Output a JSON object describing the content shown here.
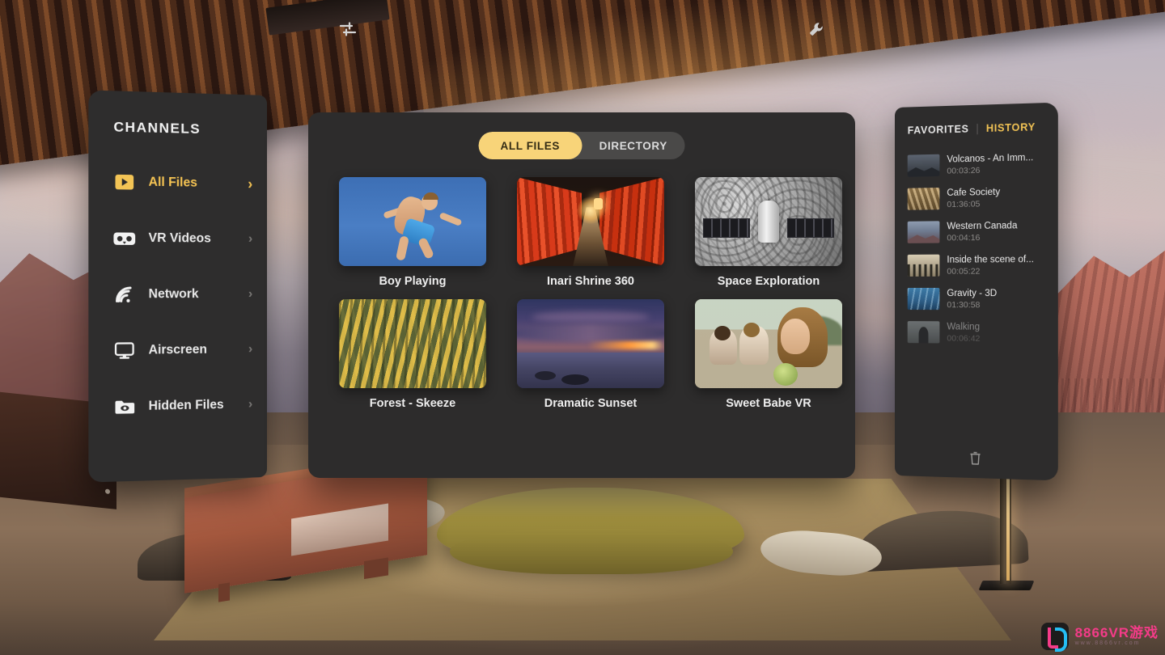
{
  "sidebar": {
    "title": "CHANNELS",
    "items": [
      {
        "label": "All Files",
        "icon": "play-box-icon",
        "chevron": "›",
        "active": true
      },
      {
        "label": "VR Videos",
        "icon": "vr-goggles-icon",
        "chevron": "›",
        "active": false
      },
      {
        "label": "Network",
        "icon": "wifi-icon",
        "chevron": "›",
        "active": false
      },
      {
        "label": "Airscreen",
        "icon": "monitor-icon",
        "chevron": "›",
        "active": false
      },
      {
        "label": "Hidden Files",
        "icon": "folder-eye-icon",
        "chevron": "›",
        "active": false
      }
    ]
  },
  "main": {
    "filter_icon": "sliders-icon",
    "settings_icon": "wrench-icon",
    "tabs": [
      {
        "label": "ALL FILES",
        "active": true
      },
      {
        "label": "DIRECTORY",
        "active": false
      }
    ],
    "items": [
      {
        "title": "Boy Playing",
        "art": "tb-boy"
      },
      {
        "title": "Inari Shrine 360",
        "art": "tb-shrine"
      },
      {
        "title": "Space Exploration",
        "art": "tb-space"
      },
      {
        "title": "Forest - Skeeze",
        "art": "tb-forest"
      },
      {
        "title": "Dramatic Sunset",
        "art": "tb-sunset"
      },
      {
        "title": "Sweet Babe VR",
        "art": "tb-babe"
      }
    ]
  },
  "right_panel": {
    "tabs": [
      {
        "label": "FAVORITES",
        "active": false
      },
      {
        "label": "HISTORY",
        "active": true
      }
    ],
    "items": [
      {
        "name": "Volcanos - An Imm...",
        "time": "00:03:26",
        "art": "t-volc"
      },
      {
        "name": "Cafe Society",
        "time": "01:36:05",
        "art": "t-cafe"
      },
      {
        "name": "Western Canada",
        "time": "00:04:16",
        "art": "t-west"
      },
      {
        "name": "Inside the scene of...",
        "time": "00:05:22",
        "art": "t-ins"
      },
      {
        "name": "Gravity - 3D",
        "time": "01:30:58",
        "art": "t-grav"
      },
      {
        "name": "Walking",
        "time": "00:06:42",
        "art": "t-walk"
      }
    ],
    "clear_icon": "trash-icon"
  },
  "watermark": {
    "text": "8866VR游戏",
    "subtext": "www.8866vr.com"
  },
  "colors": {
    "accent": "#f6c453",
    "panel": "#2d2c2c",
    "active_pill": "#f8d479"
  }
}
